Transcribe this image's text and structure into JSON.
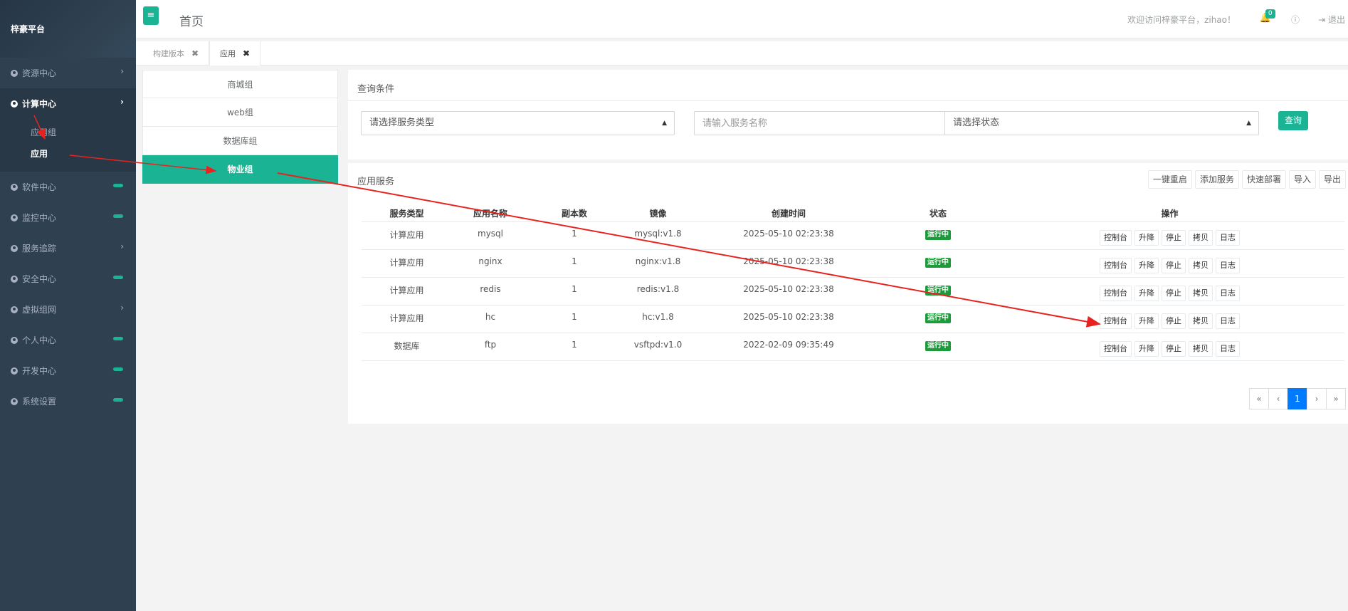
{
  "brand": "梓豪平台",
  "sidebar": {
    "items": [
      {
        "label": "资源中心",
        "marker": "chevron"
      },
      {
        "label": "计算中心",
        "marker": "chevron",
        "active": true
      },
      {
        "label": "软件中心",
        "marker": "pill"
      },
      {
        "label": "监控中心",
        "marker": "pill"
      },
      {
        "label": "服务追踪",
        "marker": "chevron"
      },
      {
        "label": "安全中心",
        "marker": "pill"
      },
      {
        "label": "虚拟组网",
        "marker": "chevron"
      },
      {
        "label": "个人中心",
        "marker": "pill"
      },
      {
        "label": "开发中心",
        "marker": "pill"
      },
      {
        "label": "系统设置",
        "marker": "pill"
      }
    ],
    "subitems": [
      {
        "label": "应用组"
      },
      {
        "label": "应用",
        "current": true
      }
    ]
  },
  "header": {
    "title": "首页",
    "welcome": "欢迎访问梓豪平台，zihao！",
    "notification_count": "0",
    "logout_label": "退出"
  },
  "tabs": [
    {
      "label": "构建版本",
      "close": "✖"
    },
    {
      "label": "应用",
      "close": "✖",
      "active": true
    }
  ],
  "groups": [
    {
      "label": "商城组"
    },
    {
      "label": "web组"
    },
    {
      "label": "数据库组"
    },
    {
      "label": "物业组",
      "active": true
    }
  ],
  "query": {
    "title": "查询条件",
    "service_type_placeholder": "请选择服务类型",
    "service_name_placeholder": "请输入服务名称",
    "status_placeholder": "请选择状态",
    "search_label": "查询"
  },
  "services": {
    "title": "应用服务",
    "toolbar": [
      "一键重启",
      "添加服务",
      "快速部署",
      "导入",
      "导出"
    ],
    "columns": [
      "服务类型",
      "应用名称",
      "副本数",
      "镜像",
      "创建时间",
      "状态",
      "操作"
    ],
    "rows": [
      {
        "type": "计算应用",
        "name": "mysql",
        "replicas": "1",
        "image": "mysql:v1.8",
        "created": "2025-05-10 02:23:38",
        "status": "运行中"
      },
      {
        "type": "计算应用",
        "name": "nginx",
        "replicas": "1",
        "image": "nginx:v1.8",
        "created": "2025-05-10 02:23:38",
        "status": "运行中"
      },
      {
        "type": "计算应用",
        "name": "redis",
        "replicas": "1",
        "image": "redis:v1.8",
        "created": "2025-05-10 02:23:38",
        "status": "运行中"
      },
      {
        "type": "计算应用",
        "name": "hc",
        "replicas": "1",
        "image": "hc:v1.8",
        "created": "2025-05-10 02:23:38",
        "status": "运行中"
      },
      {
        "type": "数据库",
        "name": "ftp",
        "replicas": "1",
        "image": "vsftpd:v1.0",
        "created": "2022-02-09 09:35:49",
        "status": "运行中"
      }
    ],
    "operations": [
      "控制台",
      "升降",
      "停止",
      "拷贝",
      "日志"
    ],
    "pagination": [
      "«",
      "‹",
      "1",
      "›",
      "»"
    ],
    "current_page": "1"
  },
  "colors": {
    "sidebar_bg": "#2f4050",
    "accent": "#1ab394",
    "status_running": "#1c9b3a",
    "page_active": "#007bff",
    "annotation_arrow": "#e8231f"
  }
}
